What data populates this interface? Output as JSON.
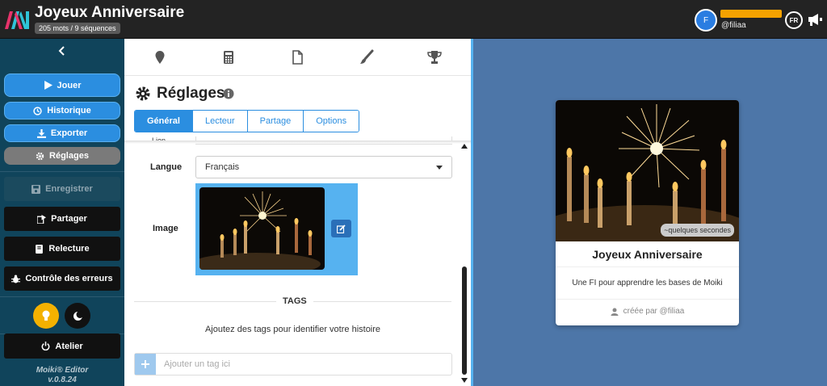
{
  "app": {
    "title": "Joyeux Anniversaire",
    "word_count": "205 mots / 9 séquences"
  },
  "user": {
    "initial": "F",
    "username": "@filiaa",
    "language": "FR"
  },
  "sidebar": {
    "play": "Jouer",
    "history": "Historique",
    "export": "Exporter",
    "settings": "Réglages",
    "save": "Enregistrer",
    "share": "Partager",
    "review": "Relecture",
    "errors": "Contrôle des erreurs",
    "workshop": "Atelier",
    "version_line1": "Moiki® Editor",
    "version_line2": "v.0.8.24"
  },
  "settings": {
    "title": "Réglages",
    "tabs": [
      "Général",
      "Lecteur",
      "Partage",
      "Options"
    ],
    "active_tab": "Général",
    "cut_label": "Lien",
    "language_label": "Langue",
    "language_value": "Français",
    "image_label": "Image",
    "tags_title": "TAGS",
    "tags_hint": "Ajoutez des tags pour identifier votre histoire",
    "tag_placeholder": "Ajouter un tag ici"
  },
  "preview": {
    "time_badge": "~quelques secondes",
    "title": "Joyeux Anniversaire",
    "description": "Une FI pour apprendre les bases de Moiki",
    "author": "créée par @filiaa"
  },
  "colors": {
    "accent": "#2b8ee0",
    "sidebar": "#10445b",
    "preview_bg": "#4d76a8",
    "theme_light": "#f4b100"
  }
}
